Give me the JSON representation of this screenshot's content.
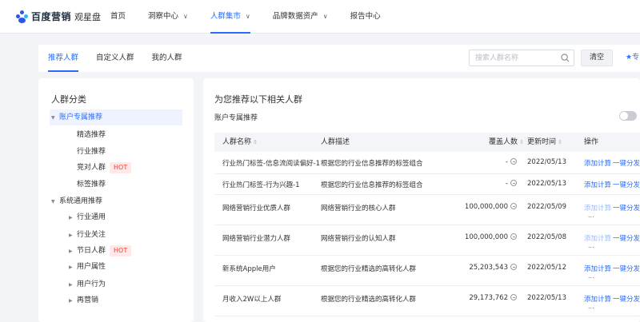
{
  "brand": {
    "name": "百度营销",
    "product": "观星盘"
  },
  "nav": [
    {
      "label": "首页",
      "chevron": false,
      "active": false
    },
    {
      "label": "洞察中心",
      "chevron": true,
      "active": false
    },
    {
      "label": "人群集市",
      "chevron": true,
      "active": true
    },
    {
      "label": "品牌数据资产",
      "chevron": true,
      "active": false
    },
    {
      "label": "报告中心",
      "chevron": false,
      "active": false
    }
  ],
  "subtabs": [
    {
      "label": "推荐人群",
      "active": true
    },
    {
      "label": "自定义人群",
      "active": false
    },
    {
      "label": "我的人群",
      "active": false
    }
  ],
  "search": {
    "placeholder": "搜索人群名称",
    "value": ""
  },
  "clear_label": "清空",
  "star_label": "★专",
  "left": {
    "title": "人群分类",
    "tree": [
      {
        "label": "账户专属推荐",
        "level": 0,
        "arrow": "down",
        "selected": true,
        "hot": false
      },
      {
        "label": "精选推荐",
        "level": 1,
        "arrow": "",
        "selected": false,
        "hot": false
      },
      {
        "label": "行业推荐",
        "level": 1,
        "arrow": "",
        "selected": false,
        "hot": false
      },
      {
        "label": "竞对人群",
        "level": 1,
        "arrow": "",
        "selected": false,
        "hot": true
      },
      {
        "label": "标签推荐",
        "level": 1,
        "arrow": "",
        "selected": false,
        "hot": false
      },
      {
        "label": "系统通用推荐",
        "level": 0,
        "arrow": "down",
        "selected": false,
        "hot": false
      },
      {
        "label": "行业通用",
        "level": 1,
        "arrow": "right",
        "selected": false,
        "hot": false
      },
      {
        "label": "行业关注",
        "level": 1,
        "arrow": "right",
        "selected": false,
        "hot": false
      },
      {
        "label": "节日人群",
        "level": 1,
        "arrow": "right",
        "selected": false,
        "hot": true
      },
      {
        "label": "用户属性",
        "level": 1,
        "arrow": "right",
        "selected": false,
        "hot": false
      },
      {
        "label": "用户行为",
        "level": 1,
        "arrow": "right",
        "selected": false,
        "hot": false
      },
      {
        "label": "再营销",
        "level": 1,
        "arrow": "right",
        "selected": false,
        "hot": false
      }
    ],
    "hot_label": "HOT"
  },
  "right": {
    "title": "为您推荐以下相关人群",
    "subtitle": "账户专属推荐",
    "columns": [
      "人群名称",
      "人群描述",
      "覆盖人数",
      "更新时间",
      "操作"
    ],
    "action_compute": "添加计算",
    "action_share": "一键分发",
    "more": "...",
    "rows": [
      {
        "name": "行业热门标签-信息流阅读偏好-1",
        "desc": "根据您的行业信息推荐的标签组合",
        "count": "-",
        "date": "2022/05/13",
        "compute_dim": false,
        "more": false
      },
      {
        "name": "行业热门标签-行为兴趣-1",
        "desc": "根据您的行业信息推荐的标签组合",
        "count": "-",
        "date": "2022/05/13",
        "compute_dim": false,
        "more": false
      },
      {
        "name": "网络营销行业优质人群",
        "desc": "网络营销行业的核心人群",
        "count": "100,000,000",
        "date": "2022/05/09",
        "compute_dim": true,
        "more": true
      },
      {
        "name": "网络营销行业潜力人群",
        "desc": "网络营销行业的认知人群",
        "count": "100,000,000",
        "date": "2022/05/08",
        "compute_dim": true,
        "more": true
      },
      {
        "name": "新系统Apple用户",
        "desc": "根据您的行业精选的高转化人群",
        "count": "25,203,543",
        "date": "2022/05/12",
        "compute_dim": false,
        "more": true
      },
      {
        "name": "月收入2W以上人群",
        "desc": "根据您的行业精选的高转化人群",
        "count": "29,173,762",
        "date": "2022/05/13",
        "compute_dim": false,
        "more": true
      }
    ]
  }
}
